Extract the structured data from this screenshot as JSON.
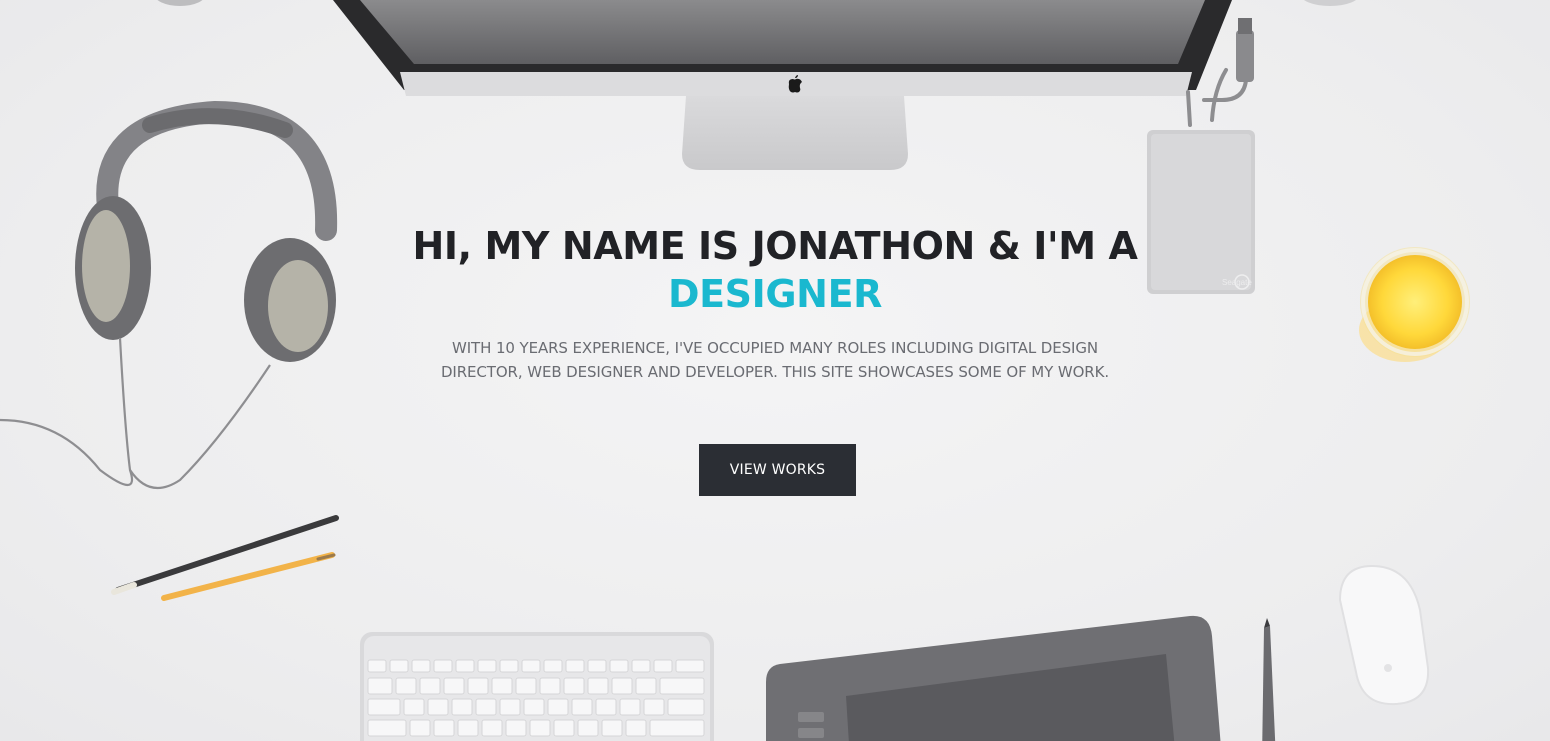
{
  "hero": {
    "headline": "HI, MY NAME IS JONATHON & I'M A",
    "headline_accent": "DESIGNER",
    "tagline": "WITH 10 YEARS EXPERIENCE, I'VE OCCUPIED MANY ROLES INCLUDING DIGITAL DESIGN DIRECTOR, WEB DESIGNER AND DEVELOPER. THIS SITE SHOWCASES SOME OF MY WORK.",
    "cta_label": "VIEW WORKS",
    "harddrive_brand": "Seagate"
  },
  "colors": {
    "accent": "#1ab8cf",
    "heading": "#212226",
    "body_text": "#6a6c72",
    "button_bg": "#2b2e34",
    "button_text": "#ffffff",
    "background": "#eeeeef"
  },
  "icons": [
    "apple-logo-icon"
  ]
}
